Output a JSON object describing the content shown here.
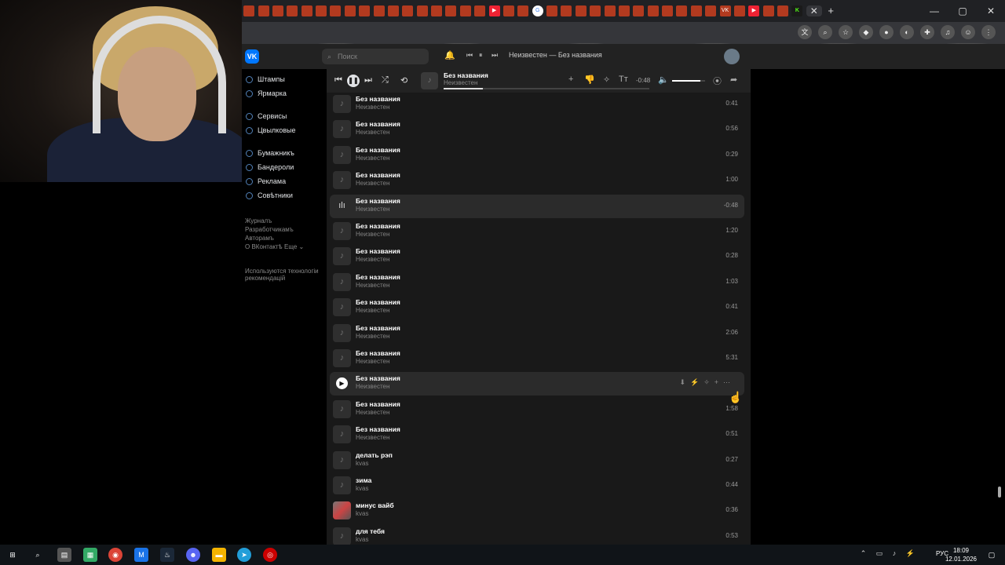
{
  "browser": {
    "tab_count_label": "",
    "window_controls": [
      "—",
      "▢",
      "✕"
    ],
    "new_tab": "+",
    "close_tab": "✕"
  },
  "vk": {
    "search_placeholder": "Поиск",
    "now_playing_header": "Неизвестен — Без названия",
    "nav": [
      {
        "label": "Штампы",
        "icon": "circle-icon"
      },
      {
        "label": "Ярмарка",
        "icon": "bag-icon"
      },
      {
        "label": "Сервисы",
        "icon": "grid-icon"
      },
      {
        "label": "Цвылковые",
        "icon": "coins-icon"
      },
      {
        "label": "Бумажникъ",
        "icon": "bookmark-icon"
      },
      {
        "label": "Бандероли",
        "icon": "box-icon"
      },
      {
        "label": "Реклама",
        "icon": "megaphone-icon"
      },
      {
        "label": "Совѣтники",
        "icon": "help-icon"
      }
    ],
    "footer_links": [
      "Журналъ",
      "Разработчикамъ",
      "Авторамъ",
      "О ВКонтактѣ",
      "Еще ⌄"
    ],
    "footer_note_1": "Используются технологіи",
    "footer_note_2": "рекомендацій"
  },
  "player": {
    "title": "Без названия",
    "artist": "Неизвестен",
    "time": "-0:48",
    "progress": 0.19,
    "volume": 0.85
  },
  "tracks": [
    {
      "title": "Без названия",
      "artist": "Неизвестен",
      "duration": "0:41",
      "state": "normal"
    },
    {
      "title": "Без названия",
      "artist": "Неизвестен",
      "duration": "0:56",
      "state": "normal"
    },
    {
      "title": "Без названия",
      "artist": "Неизвестен",
      "duration": "0:29",
      "state": "normal"
    },
    {
      "title": "Без названия",
      "artist": "Неизвестен",
      "duration": "1:00",
      "state": "normal"
    },
    {
      "title": "Без названия",
      "artist": "Неизвестен",
      "duration": "-0:48",
      "state": "playing"
    },
    {
      "title": "Без названия",
      "artist": "Неизвестен",
      "duration": "1:20",
      "state": "normal"
    },
    {
      "title": "Без названия",
      "artist": "Неизвестен",
      "duration": "0:28",
      "state": "normal"
    },
    {
      "title": "Без названия",
      "artist": "Неизвестен",
      "duration": "1:03",
      "state": "normal"
    },
    {
      "title": "Без названия",
      "artist": "Неизвестен",
      "duration": "0:41",
      "state": "normal"
    },
    {
      "title": "Без названия",
      "artist": "Неизвестен",
      "duration": "2:06",
      "state": "normal"
    },
    {
      "title": "Без названия",
      "artist": "Неизвестен",
      "duration": "5:31",
      "state": "normal"
    },
    {
      "title": "Без названия",
      "artist": "Неизвестен",
      "duration": "",
      "state": "hover"
    },
    {
      "title": "Без названия",
      "artist": "Неизвестен",
      "duration": "1:58",
      "state": "normal"
    },
    {
      "title": "Без названия",
      "artist": "Неизвестен",
      "duration": "0:51",
      "state": "normal"
    },
    {
      "title": "делать рэп",
      "artist": "kvas",
      "duration": "0:27",
      "state": "normal"
    },
    {
      "title": "зима",
      "artist": "kvas",
      "duration": "0:44",
      "state": "normal"
    },
    {
      "title": "минус вайб",
      "artist": "kvas",
      "duration": "0:36",
      "state": "cover"
    },
    {
      "title": "для тебя",
      "artist": "kvas",
      "duration": "0:53",
      "state": "normal"
    }
  ],
  "taskbar": {
    "lang": "РУС",
    "time": "18:09",
    "date": "12.01.2026"
  },
  "colors": {
    "vk_blue": "#0077ff",
    "panel": "#191919",
    "accent": "#5181b8"
  }
}
